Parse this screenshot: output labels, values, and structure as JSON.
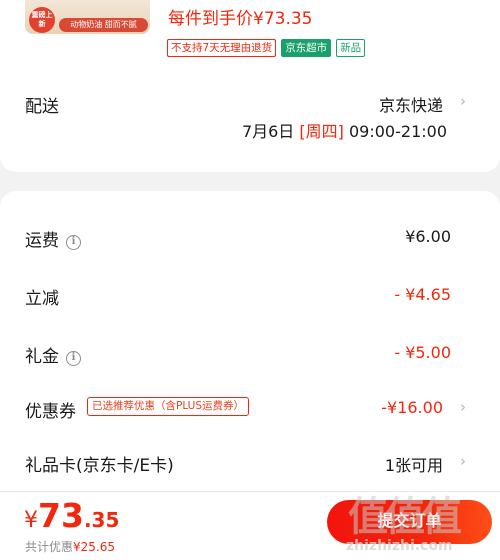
{
  "product": {
    "image_stamp": "重磅上新",
    "image_strip": "动物奶油 甜而不腻",
    "price_note": "每件到手价¥73.35",
    "tags": [
      "不支持7天无理由退货",
      "京东超市",
      "新品"
    ]
  },
  "shipping": {
    "label": "配送",
    "method": "京东快递",
    "date": "7月6日",
    "weekday": "[周四]",
    "time": "09:00-21:00"
  },
  "fees": {
    "freight": {
      "label": "运费",
      "value": "¥6.00"
    },
    "instant_discount": {
      "label": "立减",
      "value": "- ¥4.65"
    },
    "gift_money": {
      "label": "礼金",
      "value": "- ¥5.00"
    },
    "coupon": {
      "label": "优惠券",
      "tag": "已选推荐优惠（含PLUS运费券）",
      "value": "-¥16.00"
    },
    "gift_card": {
      "label": "礼品卡(京东卡/E卡)",
      "value": "1张可用"
    }
  },
  "bottom": {
    "currency": "¥",
    "total_int": "73",
    "total_dec": ".35",
    "saved_label": "共计优惠",
    "saved_amount": "¥25.65",
    "submit_label": "提交订单",
    "watermark_zh": "值值值",
    "watermark_url": "zhizhizhi.com"
  },
  "colors": {
    "accent": "#f2270c",
    "green": "#1aa16b",
    "muted": "#8c8c8c"
  },
  "icons": {
    "info": "info-circle-icon",
    "chevron": "chevron-right-icon"
  }
}
